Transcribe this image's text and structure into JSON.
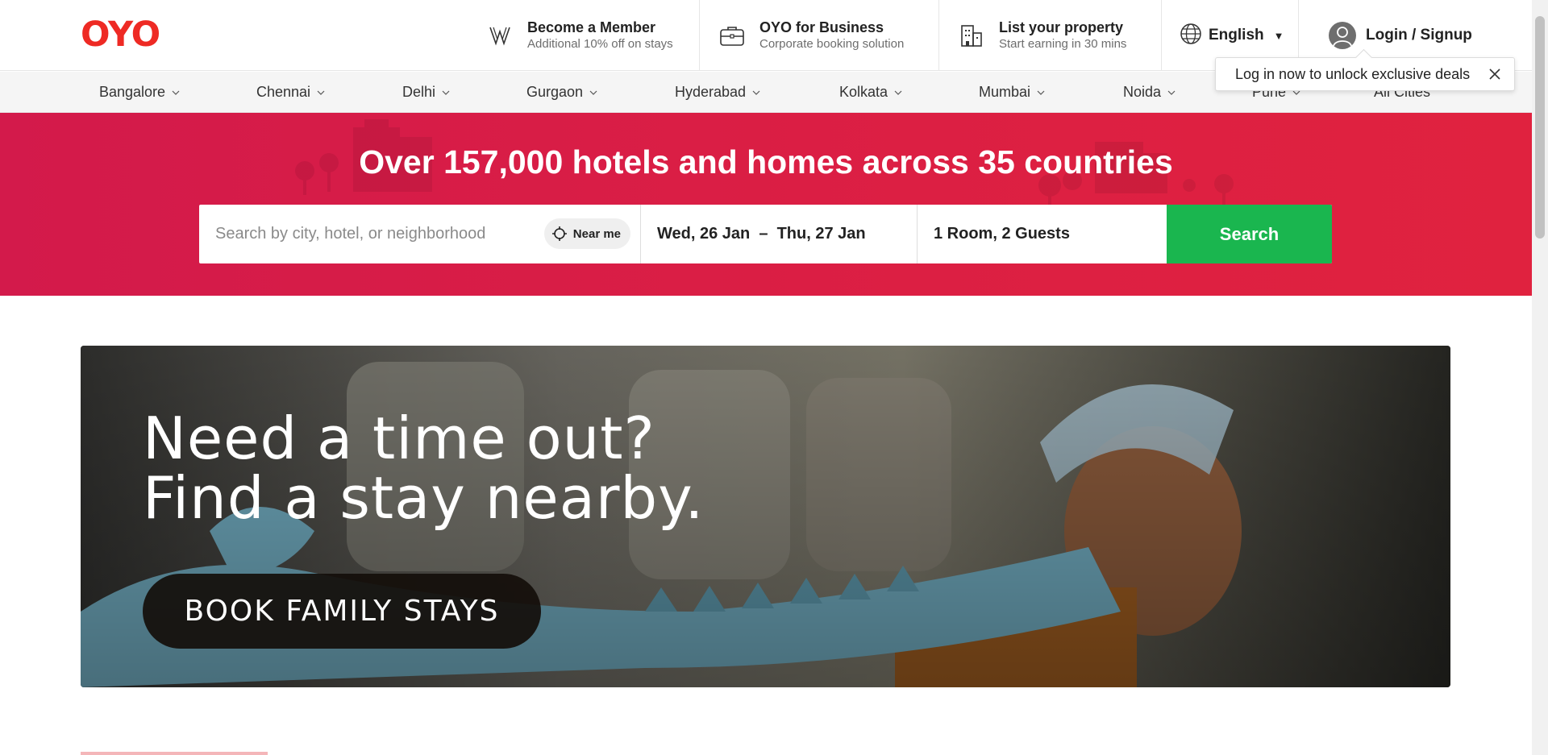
{
  "header": {
    "logo": "OYO",
    "member": {
      "title": "Become a Member",
      "subtitle": "Additional 10% off on stays",
      "icon": "wizard-w-icon"
    },
    "business": {
      "title": "OYO for Business",
      "subtitle": "Corporate booking solution",
      "icon": "briefcase-icon"
    },
    "property": {
      "title": "List your property",
      "subtitle": "Start earning in 30 mins",
      "icon": "building-icon"
    },
    "language": {
      "label": "English",
      "icon": "globe-icon"
    },
    "login": {
      "label": "Login / Signup",
      "icon": "user-avatar-icon"
    }
  },
  "cities": [
    {
      "label": "Bangalore"
    },
    {
      "label": "Chennai"
    },
    {
      "label": "Delhi"
    },
    {
      "label": "Gurgaon"
    },
    {
      "label": "Hyderabad"
    },
    {
      "label": "Kolkata"
    },
    {
      "label": "Mumbai"
    },
    {
      "label": "Noida"
    },
    {
      "label": "Pune"
    },
    {
      "label": "All Cities"
    }
  ],
  "tooltip": {
    "text": "Log in now to unlock exclusive deals"
  },
  "hero": {
    "title": "Over 157,000 hotels and homes across 35 countries",
    "search_placeholder": "Search by city, hotel, or neighborhood",
    "near_me": "Near me",
    "dates": "Wed, 26 Jan  –  Thu, 27 Jan",
    "guests": "1 Room, 2 Guests",
    "search_button": "Search"
  },
  "banner": {
    "line1": "Need a time out?",
    "line2": "Find a stay nearby.",
    "cta": "BOOK FAMILY STAYS"
  },
  "colors": {
    "brand_red": "#ee2a24",
    "hero_bg": "#d91e48",
    "search_green": "#1ab64f"
  }
}
